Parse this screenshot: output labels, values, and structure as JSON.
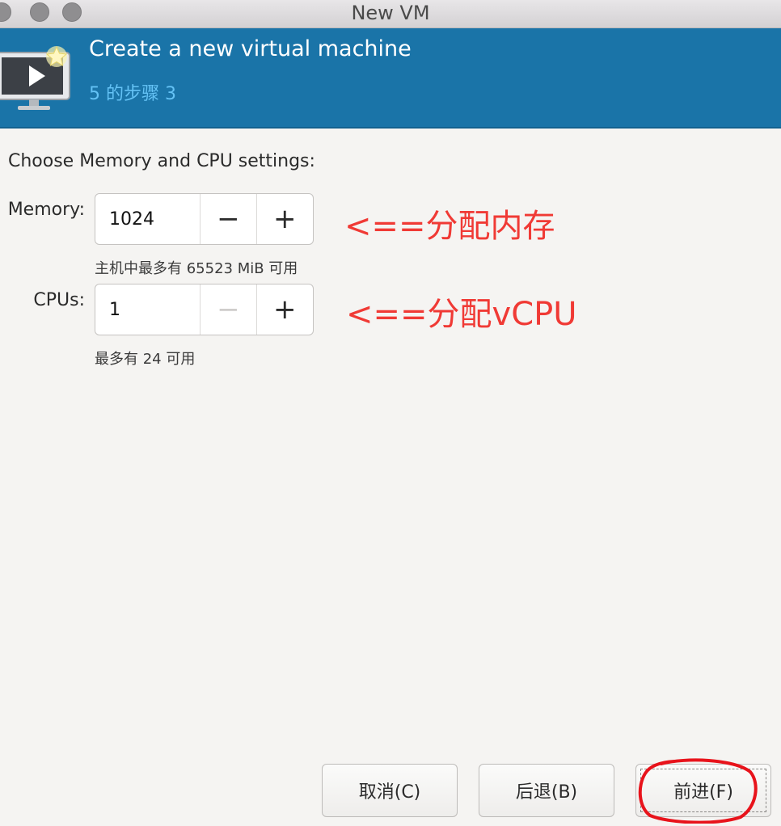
{
  "window": {
    "title": "New VM"
  },
  "header": {
    "title": "Create a new virtual machine",
    "step": "5 的步骤 3"
  },
  "form": {
    "prompt": "Choose Memory and CPU settings:",
    "memory": {
      "label": "Memory:",
      "value": "1024",
      "hint": "主机中最多有 65523 MiB 可用"
    },
    "cpus": {
      "label": "CPUs:",
      "value": "1",
      "hint": "最多有 24 可用"
    }
  },
  "annotations": {
    "memory_note": "<==分配内存",
    "cpu_note": "<==分配vCPU"
  },
  "footer": {
    "cancel_label": "取消(C)",
    "back_label": "后退(B)",
    "forward_label": "前进(F)"
  },
  "icons": {
    "minus": "−",
    "plus": "+"
  },
  "colors": {
    "banner": "#1a74a8",
    "step_text": "#64c2f5",
    "annotation": "#f03a35"
  }
}
